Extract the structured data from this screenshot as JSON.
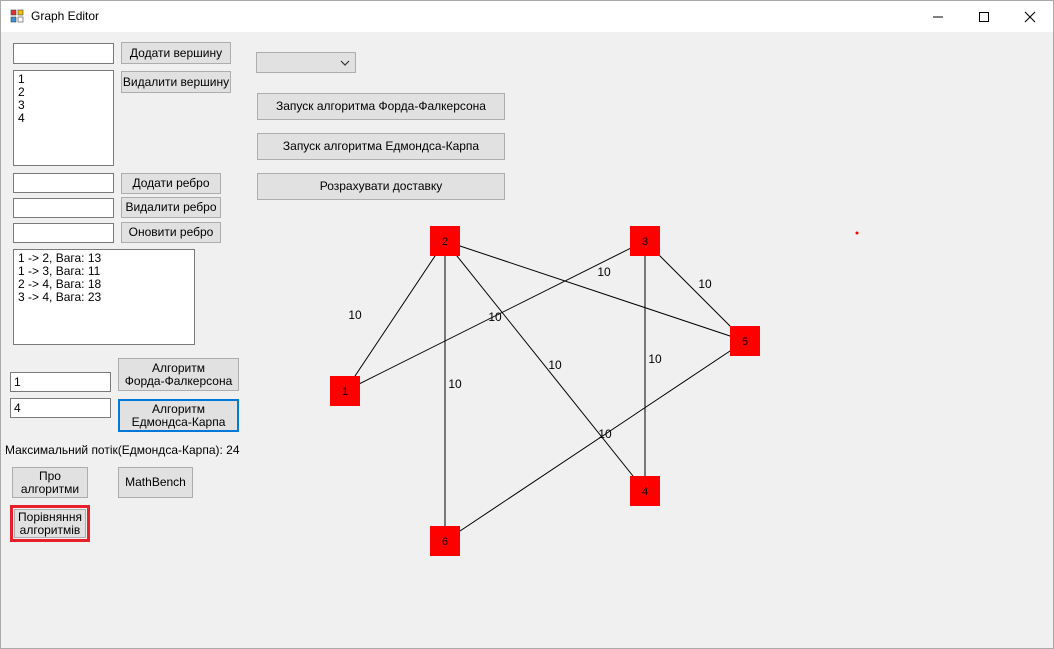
{
  "window": {
    "title": "Graph Editor"
  },
  "vertex": {
    "input_value": "",
    "add_label": "Додати вершину",
    "remove_label": "Видалити вершину",
    "items": [
      "1",
      "2",
      "3",
      "4"
    ]
  },
  "edge": {
    "input_add_value": "",
    "input_remove_value": "",
    "input_update_value": "",
    "add_label": "Додати ребро",
    "remove_label": "Видалити ребро",
    "update_label": "Оновити ребро",
    "items": [
      "1 -> 2, Вага: 13",
      "1 -> 3, Вага: 11",
      "2 -> 4, Вага: 18",
      "3 -> 4, Вага: 23"
    ]
  },
  "algo": {
    "source_value": "1",
    "sink_value": "4",
    "ff_label_1": "Алгоритм",
    "ff_label_2": "Форда-Фалкерсона",
    "ek_label_1": "Алгоритм",
    "ek_label_2": "Едмондса-Карпа",
    "max_flow_text": "Максимальний потік(Едмондса-Карпа): 24"
  },
  "bottom": {
    "about_1": "Про",
    "about_2": "алгоритми",
    "mathbench": "MathBench",
    "compare_1": "Порівняння",
    "compare_2": "алгоритмів"
  },
  "top_actions": {
    "combo_value": "",
    "run_ff": "Запуск алгоритма Форда-Фалкерсона",
    "run_ek": "Запуск алгоритма Едмондса-Карпа",
    "delivery": "Розрахувати доставку"
  },
  "graph": {
    "node_color": "#ff0000",
    "nodes": [
      {
        "id": "1"
      },
      {
        "id": "2"
      },
      {
        "id": "3"
      },
      {
        "id": "4"
      },
      {
        "id": "5"
      },
      {
        "id": "6"
      }
    ],
    "edges": [
      {
        "from": "1",
        "to": "2",
        "weight": "10"
      },
      {
        "from": "1",
        "to": "3",
        "weight": "10"
      },
      {
        "from": "2",
        "to": "5",
        "weight": "10"
      },
      {
        "from": "2",
        "to": "4",
        "weight": "10"
      },
      {
        "from": "2",
        "to": "6",
        "weight": "10"
      },
      {
        "from": "3",
        "to": "5",
        "weight": "10"
      },
      {
        "from": "3",
        "to": "4",
        "weight": "10"
      },
      {
        "from": "5",
        "to": "6",
        "weight": "10"
      }
    ]
  }
}
